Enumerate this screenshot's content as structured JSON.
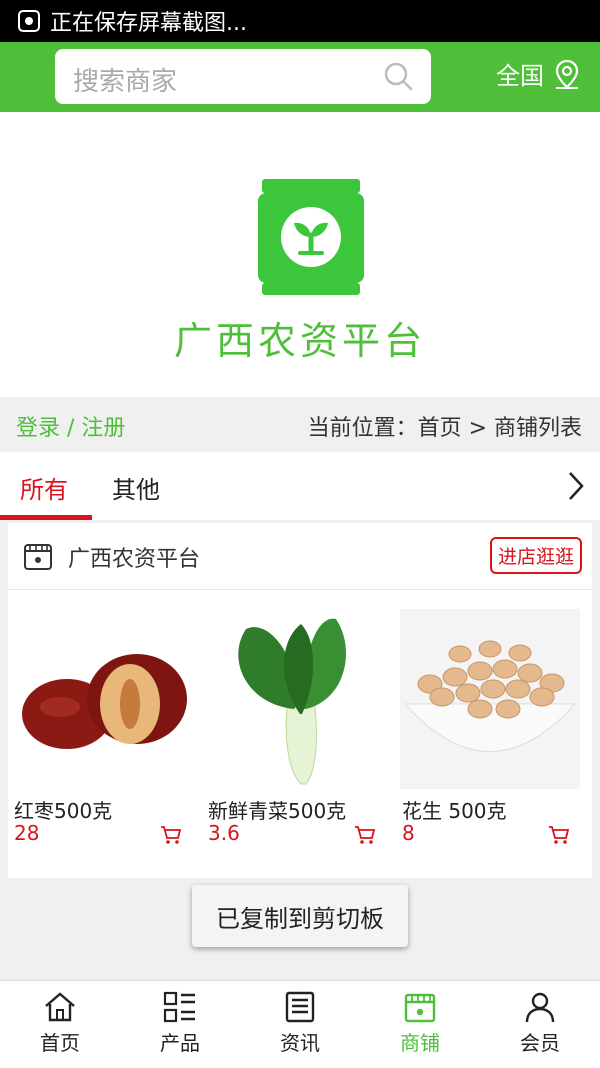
{
  "status_bar": {
    "text": "正在保存屏幕截图...",
    "icon": "screenshot-icon"
  },
  "header": {
    "search_placeholder": "搜索商家",
    "region_label": "全国",
    "brand_color": "#4fbf3a"
  },
  "banner": {
    "title": "广西农资平台"
  },
  "info_bar": {
    "login_label": "登录 / 注册",
    "breadcrumb": "当前位置：首页 > 商铺列表"
  },
  "tabs": [
    {
      "label": "所有",
      "active": true
    },
    {
      "label": "其他",
      "active": false
    }
  ],
  "shop": {
    "name": "广西农资平台",
    "visit_label": "进店逛逛",
    "products": [
      {
        "name": "红枣500克",
        "price": "28"
      },
      {
        "name": "新鲜青菜500克",
        "price": "3.6"
      },
      {
        "name": "花生 500克",
        "price": "8"
      }
    ]
  },
  "toast": "已复制到剪切板",
  "bottom_nav": [
    {
      "label": "首页",
      "icon": "home-icon"
    },
    {
      "label": "产品",
      "icon": "grid-list-icon"
    },
    {
      "label": "资讯",
      "icon": "news-icon"
    },
    {
      "label": "商铺",
      "icon": "store-icon",
      "active": true
    },
    {
      "label": "会员",
      "icon": "user-icon"
    }
  ],
  "accent_color": "#d7141c"
}
